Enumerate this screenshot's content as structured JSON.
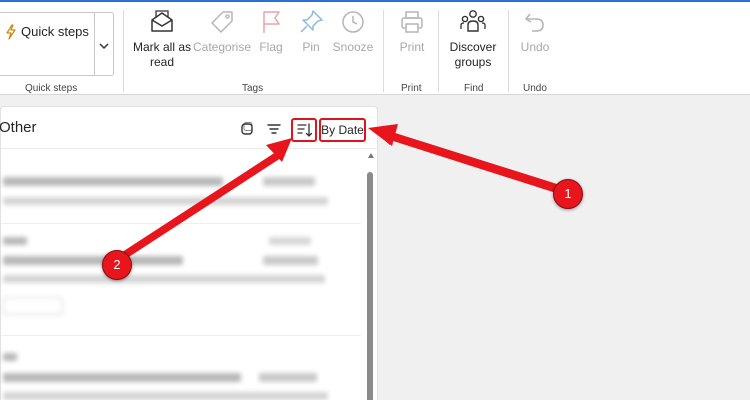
{
  "ribbon": {
    "quick_steps_label": "Quick steps",
    "groups": {
      "quick_steps": "Quick steps",
      "tags": "Tags",
      "print": "Print",
      "find": "Find",
      "undo": "Undo"
    },
    "buttons": {
      "mark_all_read_line1": "Mark all as",
      "mark_all_read_line2": "read",
      "categorise": "Categorise",
      "flag": "Flag",
      "pin": "Pin",
      "snooze": "Snooze",
      "print": "Print",
      "discover_groups_line1": "Discover",
      "discover_groups_line2": "groups",
      "undo": "Undo"
    }
  },
  "mail_list": {
    "title": "Other",
    "sort_label": "By Date"
  },
  "annotations": {
    "badge_1": "1",
    "badge_2": "2"
  },
  "colors": {
    "annotation_red": "#e8151c",
    "accent_blue": "#2b6fd1",
    "disabled_gray": "#a8a8a8"
  }
}
